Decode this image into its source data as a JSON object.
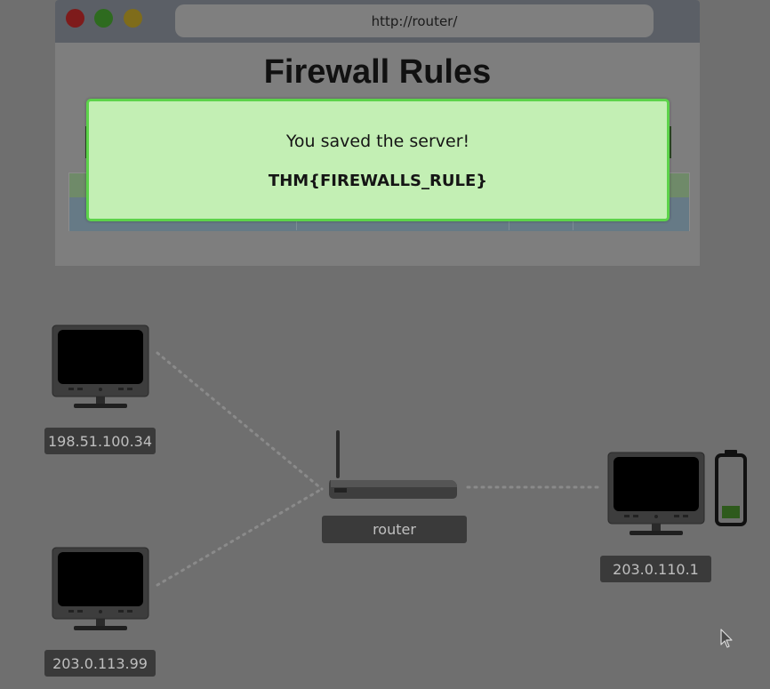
{
  "browser": {
    "url": "http://router/",
    "page_title": "Firewall Rules"
  },
  "modal": {
    "message": "You saved the server!",
    "flag": "THM{FIREWALLS_RULE}"
  },
  "network": {
    "hosts": [
      {
        "ip": "198.51.100.34",
        "icon": "monitor-icon"
      },
      {
        "ip": "203.0.113.99",
        "icon": "monitor-icon"
      },
      {
        "ip": "203.0.110.1",
        "icon": "monitor-icon"
      }
    ],
    "router": {
      "label": "router",
      "icon": "router-icon"
    },
    "server_status_icon": "battery-icon"
  },
  "colors": {
    "backdrop": "#6f6f6f",
    "modal_bg": "#c3efb4",
    "modal_border": "#5cd34a",
    "label_bg": "#3a3a3a"
  }
}
